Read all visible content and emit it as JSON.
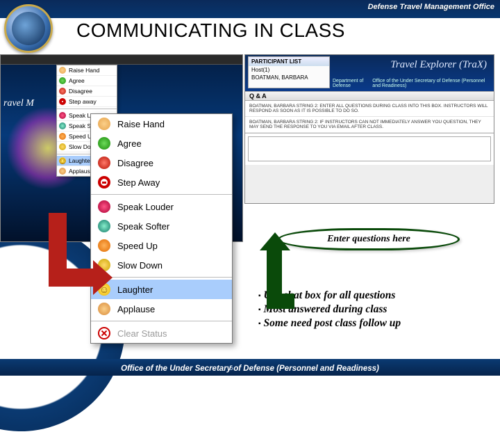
{
  "header": {
    "office": "Defense Travel Management Office",
    "title": "COMMUNICATING IN CLASS"
  },
  "left": {
    "bgText": "ravel M",
    "smallMenu": [
      "Raise Hand",
      "Agree",
      "Disagree",
      "Step away",
      "Speak Louder",
      "Speak Softer",
      "Speed Up",
      "Slow Down",
      "Laughter",
      "Applause"
    ]
  },
  "feedback": {
    "items": [
      {
        "icon": "ic-hand",
        "label": "Raise Hand",
        "sel": false
      },
      {
        "icon": "ic-green",
        "label": "Agree",
        "sel": false
      },
      {
        "icon": "ic-red",
        "label": "Disagree",
        "sel": false
      },
      {
        "icon": "ic-noentry",
        "label": "Step Away",
        "sel": false,
        "sepAfter": true
      },
      {
        "icon": "ic-spk r",
        "label": "Speak Louder",
        "sel": false
      },
      {
        "icon": "ic-spk g",
        "label": "Speak Softer",
        "sel": false
      },
      {
        "icon": "ic-ff",
        "label": "Speed Up",
        "sel": false
      },
      {
        "icon": "ic-rw",
        "label": "Slow Down",
        "sel": false,
        "sepAfter": true
      },
      {
        "icon": "ic-laugh",
        "label": "Laughter",
        "sel": true
      },
      {
        "icon": "ic-clap",
        "label": "Applause",
        "sel": false,
        "sepAfter": true
      },
      {
        "icon": "ic-x",
        "label": "Clear Status",
        "sel": false,
        "disabled": true
      }
    ]
  },
  "right": {
    "participantHeader": "PARTICIPANT LIST",
    "participants": [
      "Host(1)",
      "BOATMAN, BARBARA"
    ],
    "traxTitle": "Travel Explorer (TraX)",
    "subLeft": "Department of Defense",
    "subRight": "Office of the Under Secretary of Defense (Personnel and Readiness)",
    "qaLabel": "Q & A",
    "messages": [
      "BOATMAN, BARBARA STRING 2: ENTER ALL QUESTIONS DURING CLASS INTO THIS BOX. INSTRUCTORS WILL RESPOND AS SOON AS IT IS POSSIBLE TO DO SO.",
      "BOATMAN, BARBARA STRING 2: IF INSTRUCTORS CAN NOT IMMEDIATELY ANSWER YOU QUESTION, THEY MAY SEND THE RESPONSE TO YOU VIA EMAIL AFTER CLASS."
    ]
  },
  "callout": "Enter questions here",
  "bullets": [
    "Use chat box for all questions",
    "Most answered during class",
    "Some need post class follow up"
  ],
  "footer": {
    "text": "Office of the Under Secretary of Defense (Personnel and Readiness)",
    "page": "6"
  }
}
